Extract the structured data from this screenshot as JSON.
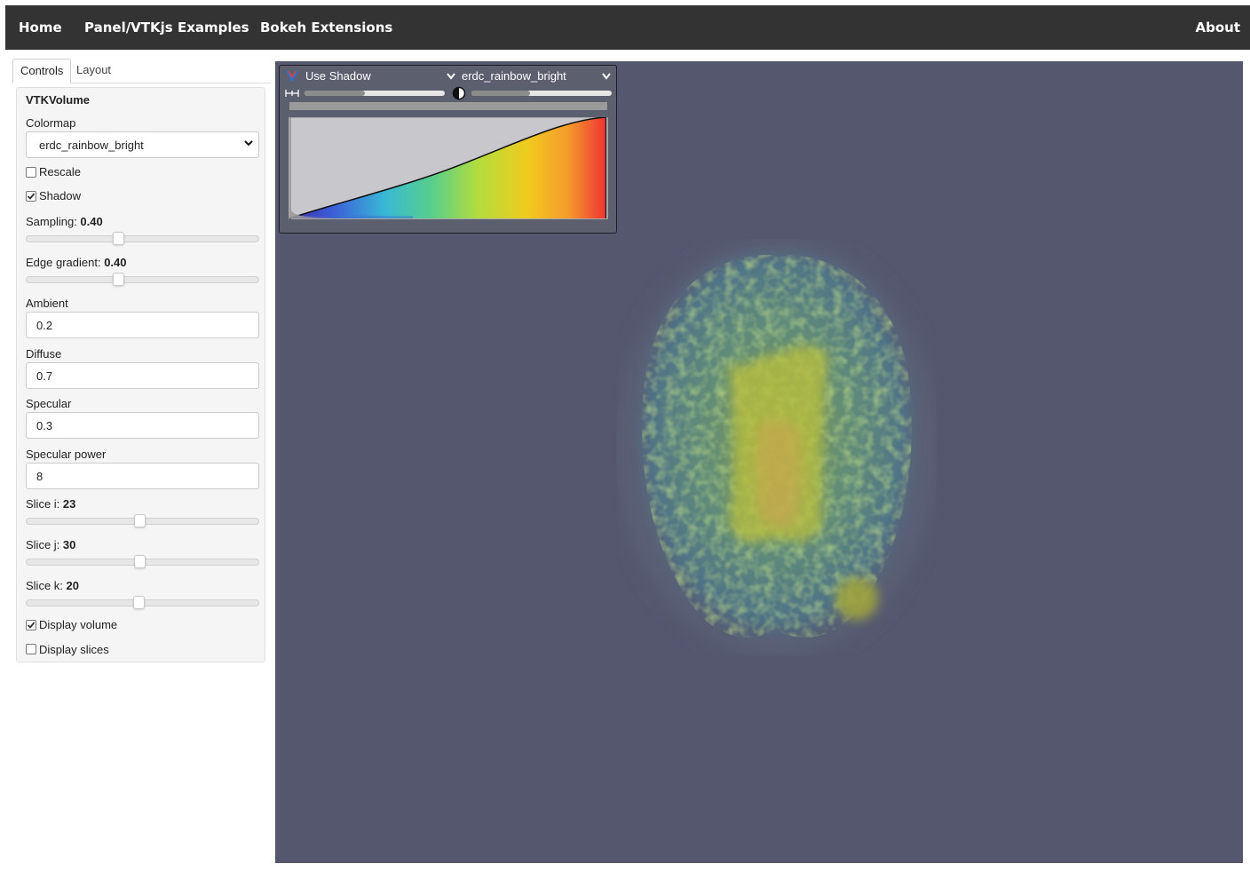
{
  "nav": {
    "home": "Home",
    "examples": "Panel/VTKjs Examples",
    "bokeh": "Bokeh Extensions",
    "about": "About"
  },
  "tabs": {
    "controls": "Controls",
    "layout": "Layout"
  },
  "panel": {
    "title": "VTKVolume",
    "colormap_label": "Colormap",
    "colormap_value": "erdc_rainbow_bright",
    "rescale_label": "Rescale",
    "rescale_checked": false,
    "shadow_label": "Shadow",
    "shadow_checked": true,
    "sampling_label": "Sampling: ",
    "sampling_value": "0.40",
    "edge_label": "Edge gradient: ",
    "edge_value": "0.40",
    "ambient_label": "Ambient",
    "ambient_value": "0.2",
    "diffuse_label": "Diffuse",
    "diffuse_value": "0.7",
    "specular_label": "Specular",
    "specular_value": "0.3",
    "specular_power_label": "Specular power",
    "specular_power_value": "8",
    "slice_i_label": "Slice i: ",
    "slice_i_value": "23",
    "slice_j_label": "Slice j: ",
    "slice_j_value": "30",
    "slice_k_label": "Slice k: ",
    "slice_k_value": "20",
    "display_volume_label": "Display volume",
    "display_volume_checked": true,
    "display_slices_label": "Display slices",
    "display_slices_checked": false
  },
  "viewer": {
    "background_color": "#54576e",
    "shadow_select": "Use Shadow",
    "colormap_select": "erdc_rainbow_bright",
    "vtk_logo_icon": "vtk-logo-icon",
    "spacing_icon": "spacing-icon",
    "contrast_icon": "contrast-icon"
  }
}
